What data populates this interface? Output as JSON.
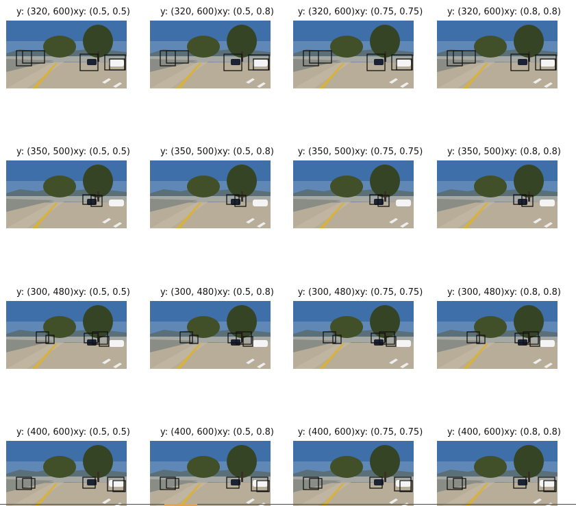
{
  "grid": {
    "rows": [
      {
        "cells": [
          {
            "title": "y: (320, 600)xy: (0.5, 0.5)"
          },
          {
            "title": "y: (320, 600)xy: (0.5, 0.8)"
          },
          {
            "title": "y: (320, 600)xy: (0.75, 0.75)"
          },
          {
            "title": "y: (320, 600)xy: (0.8, 0.8)"
          }
        ]
      },
      {
        "cells": [
          {
            "title": "y: (350, 500)xy: (0.5, 0.5)"
          },
          {
            "title": "y: (350, 500)xy: (0.5, 0.8)"
          },
          {
            "title": "y: (350, 500)xy: (0.75, 0.75)"
          },
          {
            "title": "y: (350, 500)xy: (0.8, 0.8)"
          }
        ]
      },
      {
        "cells": [
          {
            "title": "y: (300, 480)xy: (0.5, 0.5)"
          },
          {
            "title": "y: (300, 480)xy: (0.5, 0.8)"
          },
          {
            "title": "y: (300, 480)xy: (0.75, 0.75)"
          },
          {
            "title": "y: (300, 480)xy: (0.8, 0.8)"
          }
        ]
      },
      {
        "cells": [
          {
            "title": "y: (400, 600)xy: (0.5, 0.5)"
          },
          {
            "title": "y: (400, 600)xy: (0.5, 0.8)"
          },
          {
            "title": "y: (400, 600)xy: (0.75, 0.75)"
          },
          {
            "title": "y: (400, 600)xy: (0.8, 0.8)"
          }
        ]
      }
    ]
  },
  "colors": {
    "sky": "#3f6fa8",
    "road": "#b7ad99",
    "tree": "#42502a",
    "lane": "#d8b23b",
    "box": "#111111"
  }
}
